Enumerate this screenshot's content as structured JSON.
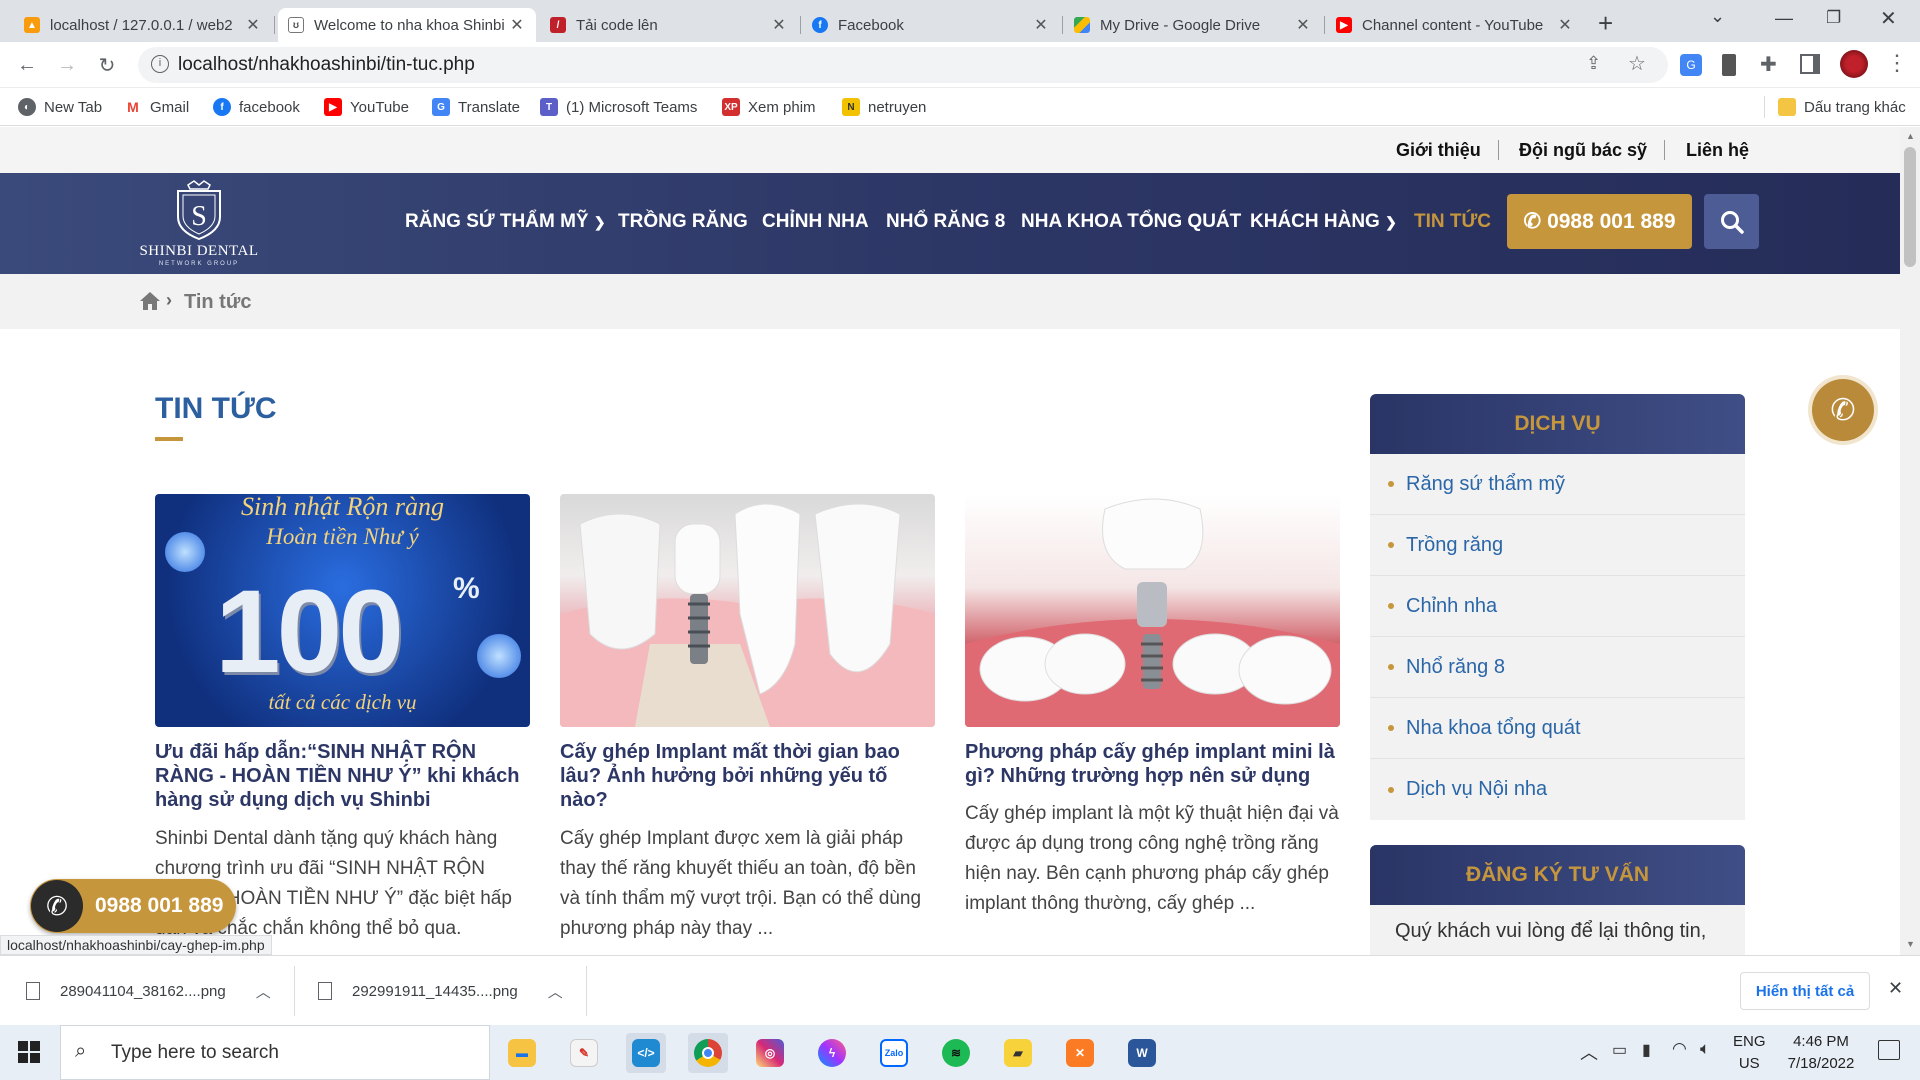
{
  "browser": {
    "tabs": [
      {
        "title": "localhost / 127.0.0.1 / web2",
        "icon": "phpmyadmin-icon",
        "color": "#f89c0e"
      },
      {
        "title": "Welcome to nha khoa Shinbi",
        "icon": "tooth-icon",
        "color": "#555555"
      },
      {
        "title": "Tải code lên",
        "icon": "upload-icon",
        "color": "#c0202a"
      },
      {
        "title": "Facebook",
        "icon": "facebook-icon",
        "color": "#1877f2"
      },
      {
        "title": "My Drive - Google Drive",
        "icon": "google-drive-icon",
        "color": "#34a853"
      },
      {
        "title": "Channel content - YouTube",
        "icon": "youtube-icon",
        "color": "#ff0000"
      }
    ],
    "url": "localhost/nhakhoashinbi/tin-tuc.php",
    "bookmarks": [
      {
        "label": "New Tab",
        "icon": "new-tab-icon",
        "color": "#5f6368"
      },
      {
        "label": "Gmail",
        "icon": "gmail-icon",
        "color": "#ea4335"
      },
      {
        "label": "facebook",
        "icon": "facebook-icon",
        "color": "#1877f2"
      },
      {
        "label": "YouTube",
        "icon": "youtube-icon",
        "color": "#ff0000"
      },
      {
        "label": "Translate",
        "icon": "translate-icon",
        "color": "#4285f4"
      },
      {
        "label": "(1) Microsoft Teams",
        "icon": "teams-icon",
        "color": "#5b5fc7"
      },
      {
        "label": "Xem phim",
        "icon": "xp-icon",
        "color": "#d32f2f"
      },
      {
        "label": "netruyen",
        "icon": "netruyen-icon",
        "color": "#f2c200"
      }
    ],
    "other_bookmarks": "Dấu trang khác",
    "status_url": "localhost/nhakhoashinbi/cay-ghep-im.php"
  },
  "site": {
    "top_links": [
      "Giới thiệu",
      "Đội ngũ bác sỹ",
      "Liên hệ"
    ],
    "logo_text": "SHINBI DENTAL",
    "logo_sub": "NETWORK GROUP",
    "nav": [
      {
        "label": "RĂNG SỨ THẨM MỸ",
        "dropdown": true
      },
      {
        "label": "TRỒNG RĂNG",
        "dropdown": false
      },
      {
        "label": "CHỈNH NHA",
        "dropdown": false
      },
      {
        "label": "NHỔ RĂNG 8",
        "dropdown": false
      },
      {
        "label": "NHA KHOA TỔNG QUÁT",
        "dropdown": false
      },
      {
        "label": "KHÁCH HÀNG",
        "dropdown": true
      },
      {
        "label": "TIN TỨC",
        "dropdown": false,
        "active": true
      }
    ],
    "phone": "0988 001 889",
    "breadcrumb": "Tin tức",
    "section_title": "TIN TỨC",
    "colors": {
      "navy": "#2d3766",
      "gold": "#c6963c"
    },
    "articles": [
      {
        "title": "Ưu đãi hấp dẫn:“SINH NHẬT RỘN RÀNG - HOÀN TIỀN NHƯ Ý” khi khách hàng sử dụng dịch vụ Shinbi",
        "excerpt": " Shinbi Dental dành tặng quý khách hàng chương trình ưu đãi “SINH NHẬT RỘN RÀNG - HOÀN TIỀN NHƯ Ý” đặc biệt hấp dẫn và chắc chắn không thể bỏ qua.",
        "image": {
          "line1": "Sinh nhật Rộn ràng",
          "line2": "Hoàn tiền Như ý",
          "big": "100",
          "pct": "%",
          "line3": "tất cả các dịch vụ"
        }
      },
      {
        "title": "Cấy ghép Implant mất thời gian bao lâu? Ảnh hưởng bởi những yếu tố nào?",
        "excerpt": "Cấy ghép Implant được xem là giải pháp thay thế răng khuyết thiếu an toàn, độ bền và tính thẩm mỹ vượt trội. Bạn có thể dùng phương pháp này thay ..."
      },
      {
        "title": "Phương pháp cấy ghép implant mini là gì? Những trường hợp nên sử dụng",
        "excerpt": "Cấy ghép implant là một kỹ thuật hiện đại và được áp dụng trong công nghệ trồng răng hiện nay. Bên cạnh phương pháp cấy ghép implant thông thường, cấy ghép ..."
      }
    ],
    "sidebar": {
      "services_title": "DỊCH VỤ",
      "services": [
        "Răng sứ thẩm mỹ",
        "Trồng răng",
        "Chỉnh nha",
        "Nhổ răng 8",
        "Nha khoa tổng quát",
        "Dịch vụ Nội nha"
      ],
      "register_title": "ĐĂNG KÝ TƯ VẤN",
      "register_text": "Quý khách vui lòng để lại thông tin,"
    },
    "floating_phone": "0988 001 889"
  },
  "downloads": {
    "items": [
      "289041104_38162....png",
      "292991911_14435....png"
    ],
    "show_all": "Hiển thị tất cả"
  },
  "taskbar": {
    "search_placeholder": "Type here to search",
    "apps": [
      {
        "name": "file-explorer-icon",
        "color": "#f6c342"
      },
      {
        "name": "paint-icon",
        "color": "#e8e8e8"
      },
      {
        "name": "vscode-icon",
        "color": "#1f8ad2"
      },
      {
        "name": "chrome-icon",
        "color": "#db4437"
      },
      {
        "name": "instagram-icon",
        "color": "#d62976"
      },
      {
        "name": "messenger-icon",
        "color": "#a033ff"
      },
      {
        "name": "zalo-icon",
        "color": "#0068ff"
      },
      {
        "name": "spotify-icon",
        "color": "#1db954"
      },
      {
        "name": "sticky-notes-icon",
        "color": "#f7d23a"
      },
      {
        "name": "xampp-icon",
        "color": "#fb7a24"
      },
      {
        "name": "word-icon",
        "color": "#2b579a"
      }
    ],
    "lang": "ENG",
    "region": "US",
    "time": "4:46 PM",
    "date": "7/18/2022"
  }
}
